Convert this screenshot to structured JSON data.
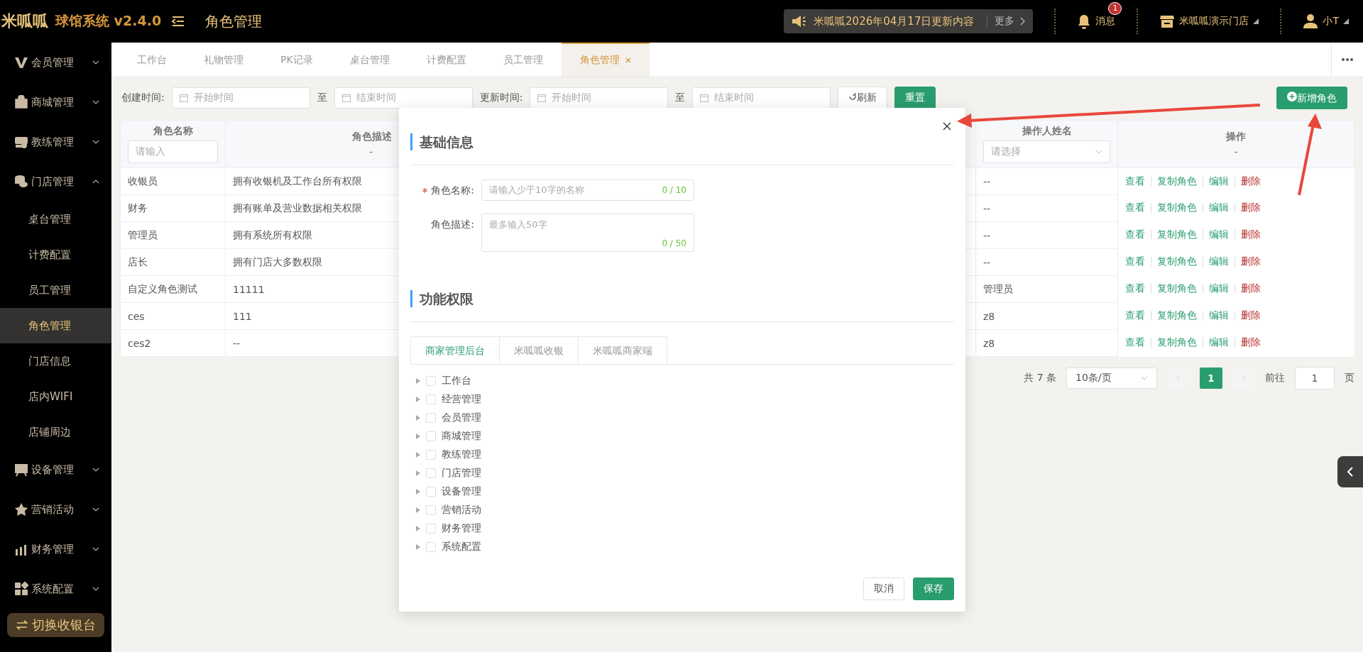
{
  "header": {
    "logo": "米呱呱",
    "app_title": "球馆系统 v2.4.0",
    "page_title": "角色管理",
    "notice": {
      "text": "米呱呱2026年04月17日更新内容",
      "more": "更多"
    },
    "messages": {
      "label": "消息",
      "badge": "1"
    },
    "store": "米呱呱演示门店",
    "user": "小T"
  },
  "sidebar": {
    "items": [
      {
        "label": "会员管理",
        "expanded": false
      },
      {
        "label": "商城管理",
        "expanded": false
      },
      {
        "label": "教练管理",
        "expanded": false
      },
      {
        "label": "门店管理",
        "expanded": true,
        "children": [
          {
            "label": "桌台管理",
            "selected": false
          },
          {
            "label": "计费配置",
            "selected": false
          },
          {
            "label": "员工管理",
            "selected": false
          },
          {
            "label": "角色管理",
            "selected": true
          },
          {
            "label": "门店信息",
            "selected": false
          },
          {
            "label": "店内WIFI",
            "selected": false
          },
          {
            "label": "店铺周边",
            "selected": false
          }
        ]
      },
      {
        "label": "设备管理",
        "expanded": false
      },
      {
        "label": "营销活动",
        "expanded": false
      },
      {
        "label": "财务管理",
        "expanded": false
      },
      {
        "label": "系统配置",
        "expanded": false
      }
    ],
    "switch_button": "切换收银台"
  },
  "tabs": [
    {
      "label": "工作台",
      "selected": false
    },
    {
      "label": "礼物管理",
      "selected": false
    },
    {
      "label": "PK记录",
      "selected": false
    },
    {
      "label": "桌台管理",
      "selected": false
    },
    {
      "label": "计费配置",
      "selected": false
    },
    {
      "label": "员工管理",
      "selected": false
    },
    {
      "label": "角色管理",
      "selected": true,
      "closable": true
    }
  ],
  "filters": {
    "created_label": "创建时间:",
    "created_start": "开始时间",
    "created_sep": "至",
    "created_end": "结束时间",
    "updated_label": "更新时间:",
    "updated_start": "开始时间",
    "updated_sep": "至",
    "updated_end": "结束时间",
    "refresh": "刷新",
    "reset": "重置",
    "add_button": "新增角色"
  },
  "table": {
    "columns": [
      {
        "title": "角色名称",
        "kind": "input",
        "filter": "请输入"
      },
      {
        "title": "角色描述",
        "kind": "text",
        "filter": "-"
      },
      {
        "title": "操作人姓名",
        "kind": "select",
        "filter": "请选择"
      },
      {
        "title": "操作",
        "kind": "text",
        "filter": "-"
      }
    ],
    "rows": [
      {
        "name": "收银员",
        "description": "拥有收银机及工作台所有权限",
        "operator": "--",
        "actions": [
          {
            "label": "查看",
            "kind": "normal"
          },
          {
            "label": "复制角色",
            "kind": "normal"
          },
          {
            "label": "编辑",
            "kind": "normal"
          },
          {
            "label": "删除",
            "kind": "danger"
          }
        ]
      },
      {
        "name": "财务",
        "description": "拥有账单及营业数据相关权限",
        "operator": "--",
        "actions": [
          {
            "label": "查看",
            "kind": "normal"
          },
          {
            "label": "复制角色",
            "kind": "normal"
          },
          {
            "label": "编辑",
            "kind": "normal"
          },
          {
            "label": "删除",
            "kind": "danger"
          }
        ]
      },
      {
        "name": "管理员",
        "description": "拥有系统所有权限",
        "operator": "--",
        "actions": [
          {
            "label": "查看",
            "kind": "normal"
          },
          {
            "label": "复制角色",
            "kind": "normal"
          },
          {
            "label": "编辑",
            "kind": "normal"
          },
          {
            "label": "删除",
            "kind": "danger"
          }
        ]
      },
      {
        "name": "店长",
        "description": "拥有门店大多数权限",
        "operator": "--",
        "actions": [
          {
            "label": "查看",
            "kind": "normal"
          },
          {
            "label": "复制角色",
            "kind": "normal"
          },
          {
            "label": "编辑",
            "kind": "normal"
          },
          {
            "label": "删除",
            "kind": "danger"
          }
        ]
      },
      {
        "name": "自定义角色测试",
        "description": "11111",
        "operator": "管理员",
        "actions": [
          {
            "label": "查看",
            "kind": "normal"
          },
          {
            "label": "复制角色",
            "kind": "normal"
          },
          {
            "label": "编辑",
            "kind": "normal"
          },
          {
            "label": "删除",
            "kind": "danger"
          }
        ]
      },
      {
        "name": "ces",
        "description": "111",
        "operator": "z8",
        "actions": [
          {
            "label": "查看",
            "kind": "normal"
          },
          {
            "label": "复制角色",
            "kind": "normal"
          },
          {
            "label": "编辑",
            "kind": "normal"
          },
          {
            "label": "删除",
            "kind": "danger"
          }
        ]
      },
      {
        "name": "ces2",
        "description": "--",
        "operator": "z8",
        "actions": [
          {
            "label": "查看",
            "kind": "normal"
          },
          {
            "label": "复制角色",
            "kind": "normal"
          },
          {
            "label": "编辑",
            "kind": "normal"
          },
          {
            "label": "删除",
            "kind": "danger"
          }
        ]
      }
    ]
  },
  "pagination": {
    "total": "共 7 条",
    "page_size": "10条/页",
    "pages": [
      {
        "label": "1",
        "selected": true
      }
    ],
    "goto_label": "前往",
    "goto_value": "1",
    "goto_suffix": "页"
  },
  "modal": {
    "section_basic": "基础信息",
    "fields": [
      {
        "label": "角色名称:",
        "required": true,
        "kind": "input",
        "placeholder": "请输入少于10字的名称",
        "counter": "0 / 10"
      },
      {
        "label": "角色描述:",
        "required": false,
        "kind": "textarea",
        "placeholder": "最多输入50字",
        "counter": "0 / 50"
      }
    ],
    "section_permissions": "功能权限",
    "tabs": [
      {
        "label": "商家管理后台",
        "selected": true
      },
      {
        "label": "米呱呱收银",
        "selected": false
      },
      {
        "label": "米呱呱商家端",
        "selected": false
      }
    ],
    "tree": [
      {
        "label": "工作台",
        "checked": false,
        "expanded": false
      },
      {
        "label": "经营管理",
        "checked": false,
        "expanded": false
      },
      {
        "label": "会员管理",
        "checked": false,
        "expanded": false
      },
      {
        "label": "商城管理",
        "checked": false,
        "expanded": false
      },
      {
        "label": "教练管理",
        "checked": false,
        "expanded": false
      },
      {
        "label": "门店管理",
        "checked": false,
        "expanded": false
      },
      {
        "label": "设备管理",
        "checked": false,
        "expanded": false
      },
      {
        "label": "营销活动",
        "checked": false,
        "expanded": false
      },
      {
        "label": "财务管理",
        "checked": false,
        "expanded": false
      },
      {
        "label": "系统配置",
        "checked": false,
        "expanded": false
      }
    ],
    "cancel": "取消",
    "save": "保存"
  }
}
